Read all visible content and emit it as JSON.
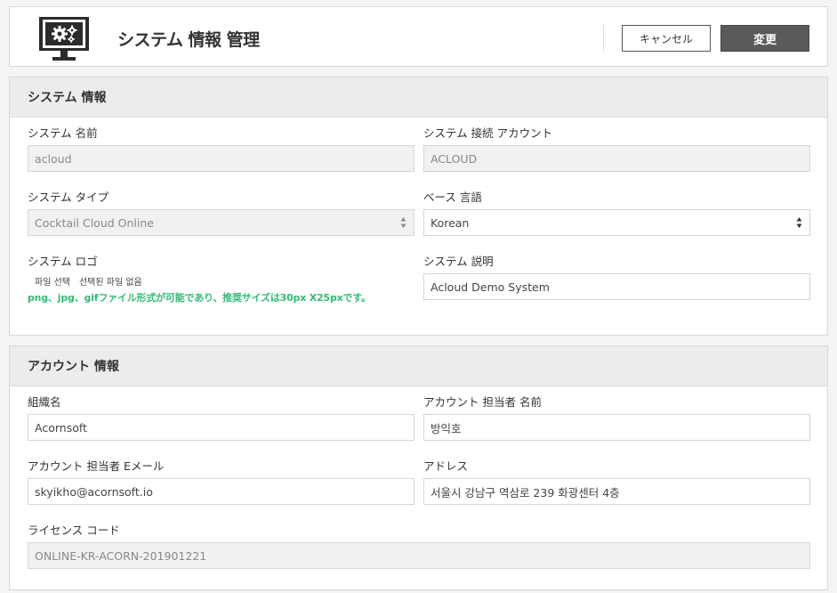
{
  "header": {
    "title": "システム 情報 管理",
    "cancel_label": "キャンセル",
    "change_label": "変更"
  },
  "system_section": {
    "title": "システム 情報",
    "name_label": "システム 名前",
    "name_value": "acloud",
    "account_label": "システム 接続 アカウント",
    "account_value": "ACLOUD",
    "type_label": "システム タイプ",
    "type_value": "Cocktail Cloud Online",
    "language_label": "ベース 言語",
    "language_value": "Korean",
    "logo_label": "システム ロゴ",
    "file_button": "파일 선택",
    "file_status": "선택된 파일 없음",
    "logo_hint": "png、jpg、gifファイル形式が可能であり、推奨サイズは30px X25pxです。",
    "description_label": "システム 説明",
    "description_value": "Acloud Demo System"
  },
  "account_section": {
    "title": "アカウント 情報",
    "org_label": "組織名",
    "org_value": "Acornsoft",
    "manager_name_label": "アカウント 担当者 名前",
    "manager_name_value": "방익호",
    "email_label": "アカウント 担当者 Eメール",
    "email_value": "skyikho@acornsoft.io",
    "address_label": "アドレス",
    "address_value": "서울시 강남구 역삼로 239 화광센터 4층",
    "license_label": "ライセンス コード",
    "license_value": "ONLINE-KR-ACORN-201901221"
  },
  "icons": {
    "header_icon": "monitor-gears-icon",
    "select_arrow": "up-down-arrows-icon"
  },
  "colors": {
    "hint": "#33bb77",
    "primary_button": "#5a5a5a",
    "section_header_bg": "#ececec"
  }
}
